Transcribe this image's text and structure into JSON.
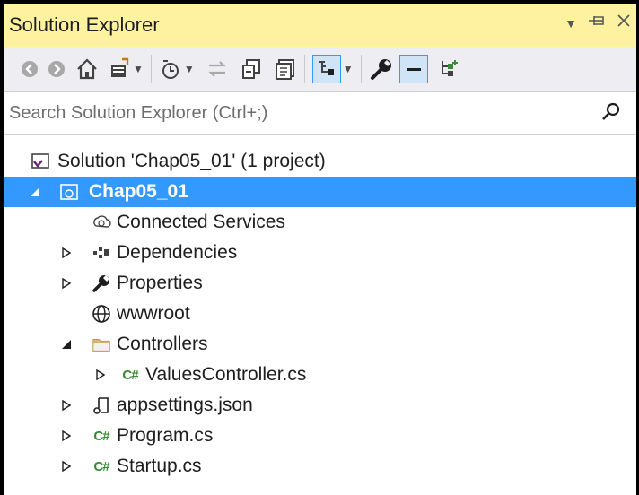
{
  "window": {
    "title": "Solution Explorer"
  },
  "search": {
    "placeholder": "Search Solution Explorer (Ctrl+;)"
  },
  "tree": {
    "solution": "Solution 'Chap05_01' (1 project)",
    "project": "Chap05_01",
    "connected_services": "Connected Services",
    "dependencies": "Dependencies",
    "properties": "Properties",
    "wwwroot": "wwwroot",
    "controllers": "Controllers",
    "values_controller": "ValuesController.cs",
    "appsettings": "appsettings.json",
    "program": "Program.cs",
    "startup": "Startup.cs"
  },
  "colors": {
    "title_bg": "#fef2a0",
    "selection": "#3399ff",
    "csharp": "#388a34",
    "toolbar_bg": "#eeeef2"
  },
  "icons": [
    "back-icon",
    "forward-icon",
    "home-icon",
    "switch-views-icon",
    "pending-changes-icon",
    "sync-icon",
    "collapse-all-icon",
    "show-all-files-icon",
    "preview-icon",
    "properties-wrench-icon",
    "pin-icon",
    "new-solution-view-icon"
  ]
}
